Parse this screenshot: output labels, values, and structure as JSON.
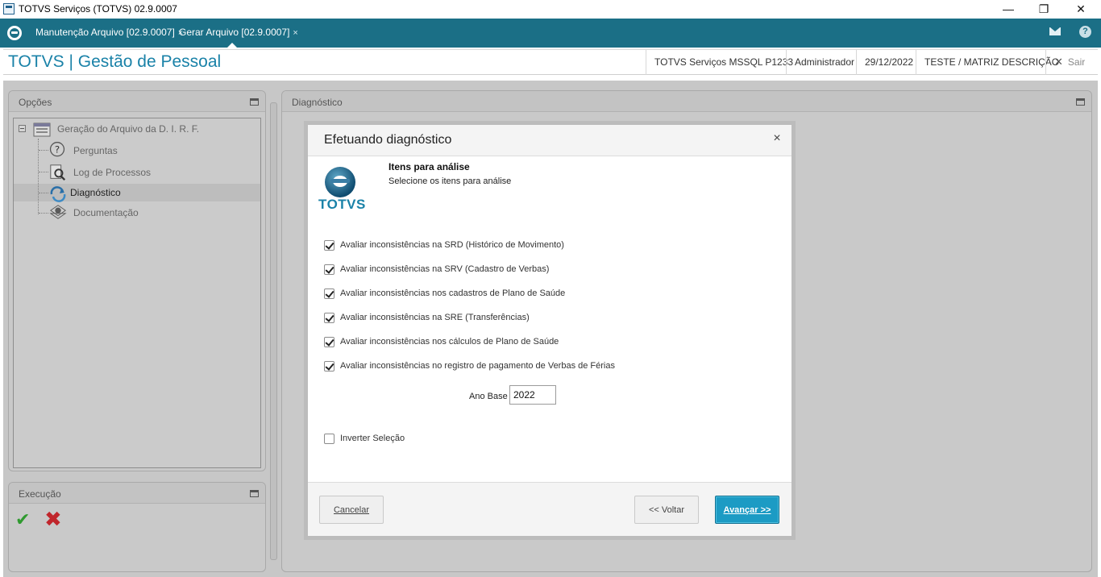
{
  "window": {
    "title": "TOTVS Serviços (TOTVS) 02.9.0007",
    "minimize": "—",
    "restore": "❐",
    "close": "✕"
  },
  "tabs": [
    {
      "label": "Manutenção Arquivo [02.9.0007]",
      "close": "×"
    },
    {
      "label": "Gerar Arquivo [02.9.0007]",
      "close": "×",
      "active": true
    }
  ],
  "header": {
    "title": "TOTVS | Gestão de Pessoal",
    "environment": "TOTVS Serviços MSSQL P1233",
    "user": "Administrador",
    "date": "29/12/2022",
    "company": "TESTE / MATRIZ DESCRIÇÃO",
    "exit_label": "Sair",
    "exit_icon": "✕",
    "help_icon": "?"
  },
  "options_panel": {
    "title": "Opções",
    "tree": {
      "root": "Geração do Arquivo da D. I. R. F.",
      "children": [
        "Perguntas",
        "Log de Processos",
        "Diagnóstico",
        "Documentação"
      ],
      "selected": "Diagnóstico"
    }
  },
  "execution_panel": {
    "title": "Execução",
    "ok_icon": "✔",
    "cancel_icon": "✖"
  },
  "diagnostic_panel": {
    "title": "Diagnóstico"
  },
  "modal": {
    "title": "Efetuando diagnóstico",
    "close": "×",
    "logo_text": "TOTVS",
    "step_title": "Itens para análise",
    "step_subtitle": "Selecione os itens para análise",
    "items": [
      {
        "label": "Avaliar inconsistências na SRD (Histórico de Movimento)",
        "checked": true
      },
      {
        "label": "Avaliar inconsistências na SRV (Cadastro de Verbas)",
        "checked": true
      },
      {
        "label": "Avaliar inconsistências nos cadastros de Plano de Saúde",
        "checked": true
      },
      {
        "label": "Avaliar inconsistências na SRE (Transferências)",
        "checked": true
      },
      {
        "label": "Avaliar inconsistências nos cálculos de Plano de Saúde",
        "checked": true
      },
      {
        "label": "Avaliar inconsistências no registro de pagamento de Verbas de Férias",
        "checked": true
      }
    ],
    "ano_base_label": "Ano Base",
    "ano_base_value": "2022",
    "invert_label": "Inverter Seleção",
    "invert_checked": false,
    "buttons": {
      "cancel": "Cancelar",
      "back": "<< Voltar",
      "next": "Avançar >>"
    }
  }
}
